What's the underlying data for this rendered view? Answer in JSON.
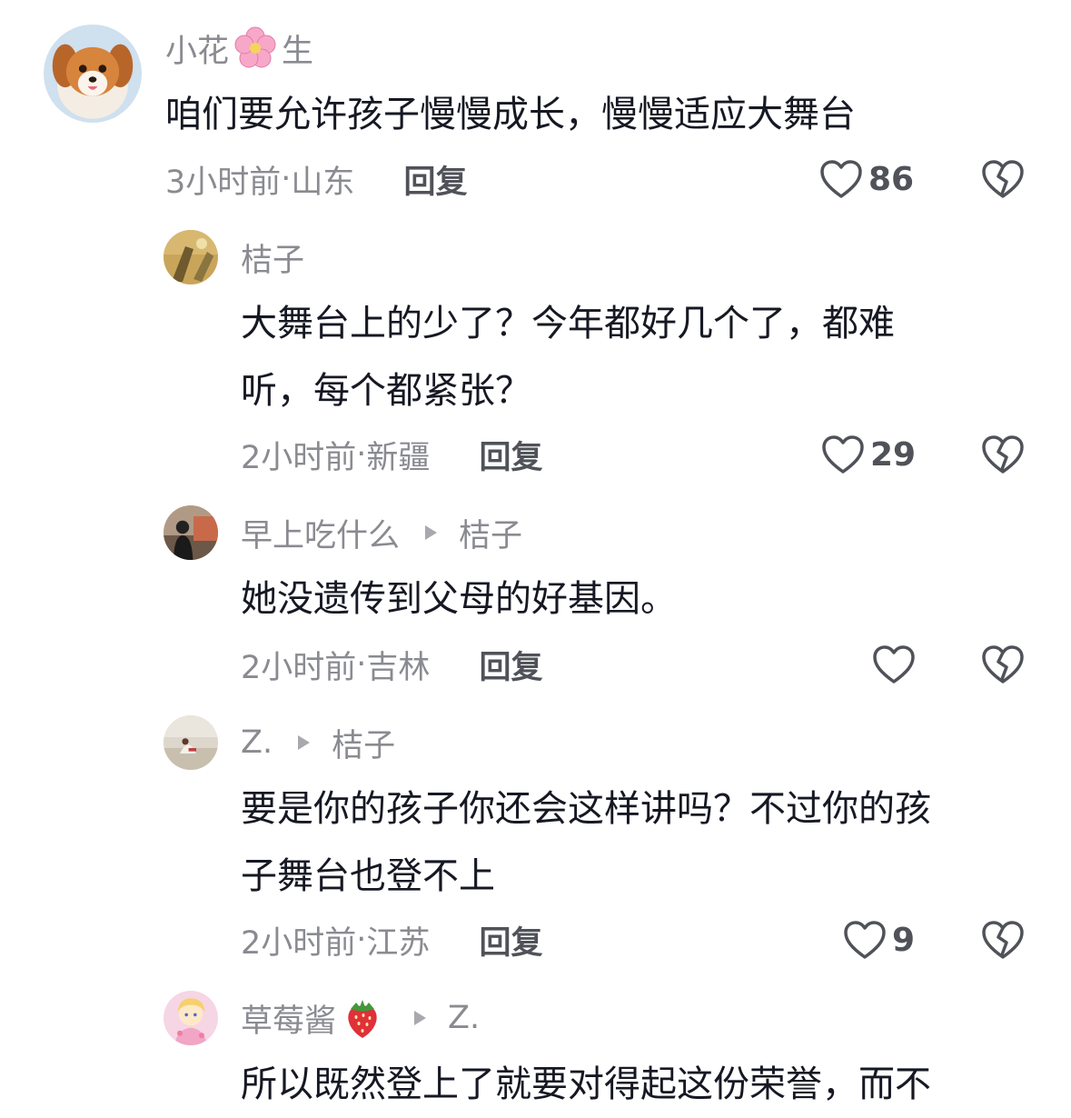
{
  "comments": [
    {
      "name": "小花",
      "name_suffix": "生",
      "name_emoji": "cherry-blossom",
      "text": "咱们要允许孩子慢慢成长，慢慢适应大舞台",
      "time": "3小时前",
      "location": "山东",
      "reply": "回复",
      "likes": "86"
    },
    {
      "name": "桔子",
      "text": "大舞台上的少了？今年都好几个了，都难\n听，每个都紧张？",
      "time": "2小时前",
      "location": "新疆",
      "reply": "回复",
      "likes": "29"
    },
    {
      "name": "早上吃什么",
      "reply_to": "桔子",
      "text": "她没遗传到父母的好基因。",
      "time": "2小时前",
      "location": "吉林",
      "reply": "回复",
      "likes": ""
    },
    {
      "name": "Z.",
      "reply_to": "桔子",
      "text": "要是你的孩子你还会这样讲吗？不过你的孩\n子舞台也登不上",
      "time": "2小时前",
      "location": "江苏",
      "reply": "回复",
      "likes": "9"
    },
    {
      "name": "草莓酱",
      "name_emoji": "strawberry",
      "reply_to": "Z.",
      "text": "所以既然登上了就要对得起这份荣誉，而不",
      "time": "",
      "location": "",
      "reply": ""
    }
  ],
  "separator": " · ",
  "colors": {
    "secondary_text": "#8a8b91",
    "primary_text": "#161823",
    "action_text": "#505259"
  }
}
